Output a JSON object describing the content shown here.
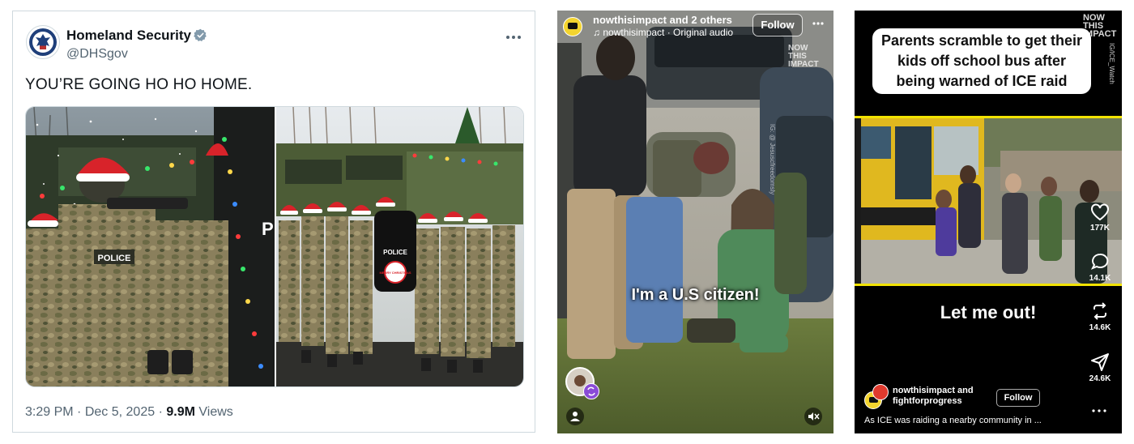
{
  "tweet": {
    "display_name": "Homeland Security",
    "handle": "@DHSgov",
    "more_icon": "more-dots-icon",
    "text": "YOU’RE GOING HO HO HOME.",
    "time": "3:29 PM",
    "date": "Dec 5, 2025",
    "views_count": "9.9M",
    "views_label": "Views",
    "vehicle_label": "P",
    "shield_label": "POLICE",
    "shield_badge": "MERRY CHRISTMAS",
    "vest_label": "POLICE",
    "colors": {
      "verified": "#829aab",
      "text": "#0f1419",
      "muted": "#536471"
    }
  },
  "reel": {
    "account": "nowthisimpact and 2 others",
    "audio": "nowthisimpact · Original audio",
    "follow_label": "Follow",
    "more_icon": "more-dots-icon",
    "watermark": "NOW THIS IMPACT",
    "side_handle": "IG: @ Jesuscfreedomsly",
    "caption": "I'm a U.S citizen!",
    "mute_icon": "speaker-muted-icon",
    "person_icon": "person-icon"
  },
  "tiktok": {
    "headline": "Parents scramble to get their kids off school bus after being warned of ICE raid",
    "watermark": "NOW THIS IMPACT",
    "side_handle": "IG/ICE_Watch",
    "caption": "Let me out!",
    "likes": "177K",
    "comments": "14.1K",
    "reposts": "14.6K",
    "shares": "24.6K",
    "account": "nowthisimpact and fightforprogress",
    "follow_label": "Follow",
    "description": "As ICE was raiding a nearby community in ...",
    "colors": {
      "accent": "#f2e300"
    }
  }
}
